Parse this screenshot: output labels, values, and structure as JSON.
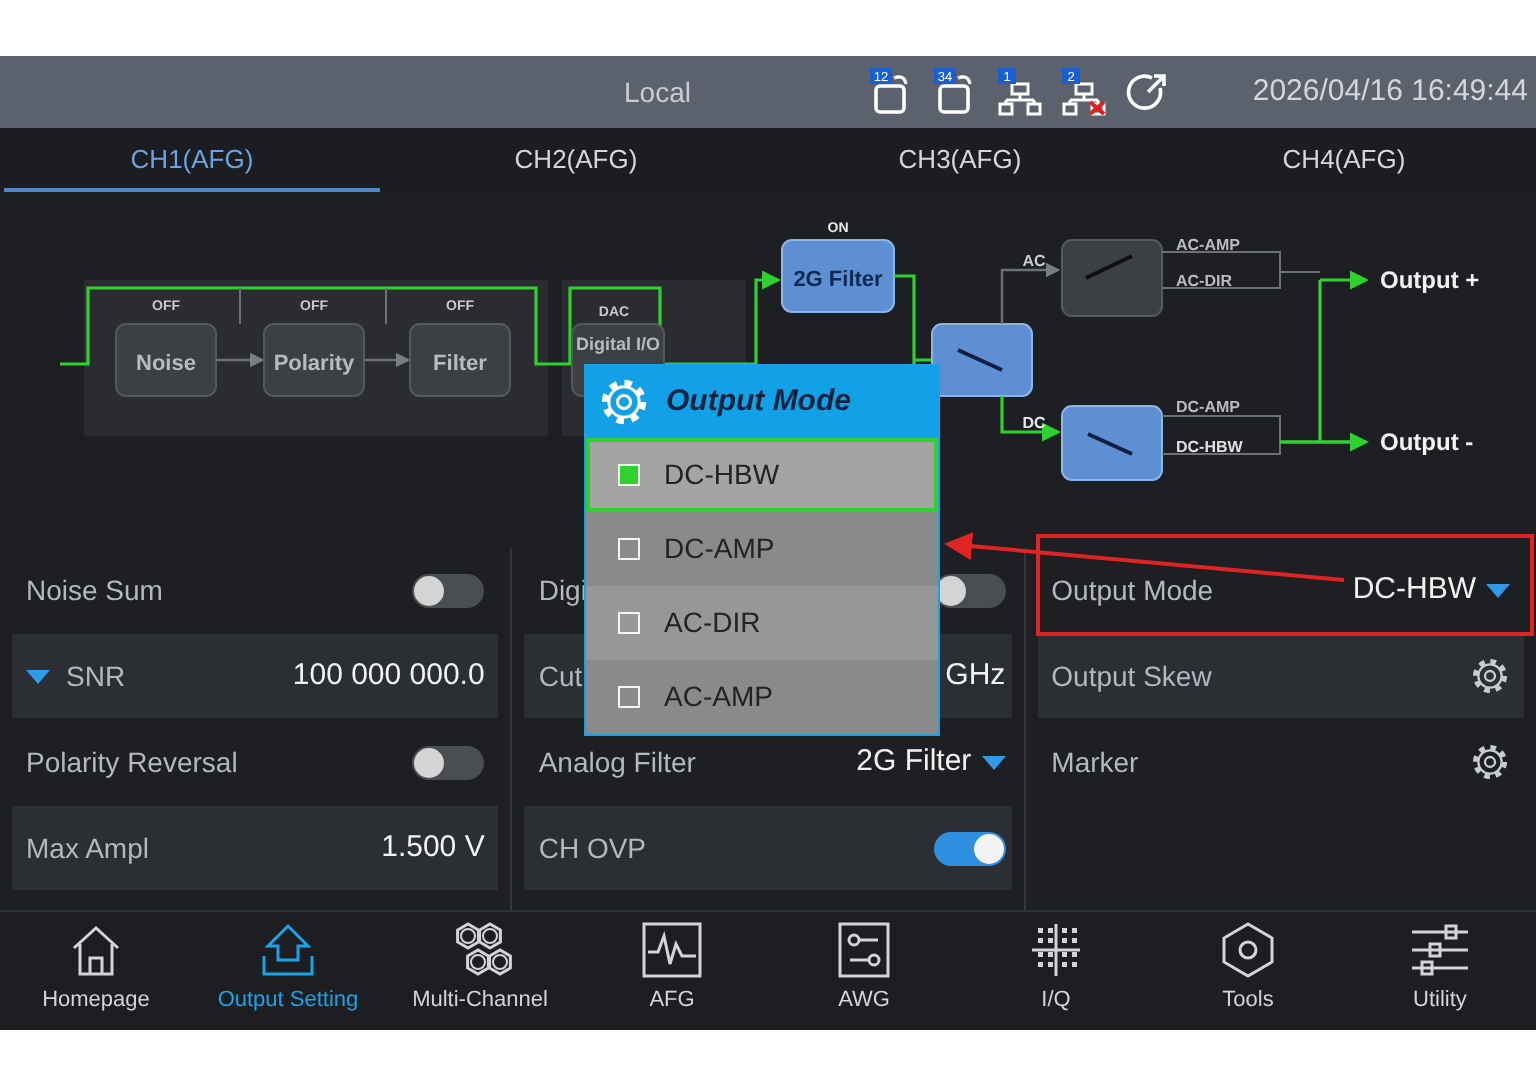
{
  "status_bar": {
    "title": "Local",
    "ports": [
      {
        "label": "12"
      },
      {
        "label": "34"
      }
    ],
    "network": [
      {
        "label": "1",
        "connected": true
      },
      {
        "label": "2",
        "connected": false
      }
    ],
    "datetime": "2026/04/16 16:49:44"
  },
  "tabs": [
    {
      "label": "CH1(AFG)",
      "selected": true
    },
    {
      "label": "CH2(AFG)",
      "selected": false
    },
    {
      "label": "CH3(AFG)",
      "selected": false
    },
    {
      "label": "CH4(AFG)",
      "selected": false
    }
  ],
  "diagram": {
    "chain": [
      {
        "state": "OFF",
        "label": "Noise",
        "active": false
      },
      {
        "state": "OFF",
        "label": "Polarity",
        "active": false
      },
      {
        "state": "OFF",
        "label": "Filter",
        "active": false
      }
    ],
    "dac": {
      "state": "DAC",
      "label": "Digital I/O"
    },
    "filter": {
      "state": "ON",
      "label": "2G Filter",
      "active": true
    },
    "ac": {
      "label": "AC",
      "paths": [
        "AC-AMP",
        "AC-DIR"
      ],
      "active": false
    },
    "dc": {
      "label": "DC",
      "paths": [
        "DC-AMP",
        "DC-HBW"
      ],
      "active": true
    },
    "outputs": [
      "Output +",
      "Output -"
    ]
  },
  "settings": [
    [
      {
        "kind": "toggle",
        "label": "Noise Sum",
        "on": false
      },
      {
        "kind": "value",
        "label": "SNR",
        "value": "100 000 000.0",
        "expandable": true
      },
      {
        "kind": "toggle",
        "label": "Polarity Reversal",
        "on": false
      },
      {
        "kind": "value",
        "label": "Max Ampl",
        "value": "1.500 V"
      }
    ],
    [
      {
        "kind": "toggle",
        "label": "Digi",
        "on": false
      },
      {
        "kind": "value",
        "label": "Cut",
        "value": "GHz"
      },
      {
        "kind": "select",
        "label": "Analog Filter",
        "value": "2G Filter"
      },
      {
        "kind": "toggle",
        "label": "CH OVP",
        "on": true
      }
    ],
    [
      {
        "kind": "select",
        "label": "Output Mode",
        "value": "DC-HBW"
      },
      {
        "kind": "gear",
        "label": "Output Skew"
      },
      {
        "kind": "gear",
        "label": "Marker"
      }
    ]
  ],
  "popup": {
    "title": "Output Mode",
    "options": [
      {
        "label": "DC-HBW",
        "selected": true
      },
      {
        "label": "DC-AMP",
        "selected": false
      },
      {
        "label": "AC-DIR",
        "selected": false
      },
      {
        "label": "AC-AMP",
        "selected": false
      }
    ]
  },
  "nav": [
    {
      "label": "Homepage",
      "selected": false
    },
    {
      "label": "Output Setting",
      "selected": true
    },
    {
      "label": "Multi-Channel",
      "selected": false
    },
    {
      "label": "AFG",
      "selected": false
    },
    {
      "label": "AWG",
      "selected": false
    },
    {
      "label": "I/Q",
      "selected": false
    },
    {
      "label": "Tools",
      "selected": false
    },
    {
      "label": "Utility",
      "selected": false
    }
  ]
}
